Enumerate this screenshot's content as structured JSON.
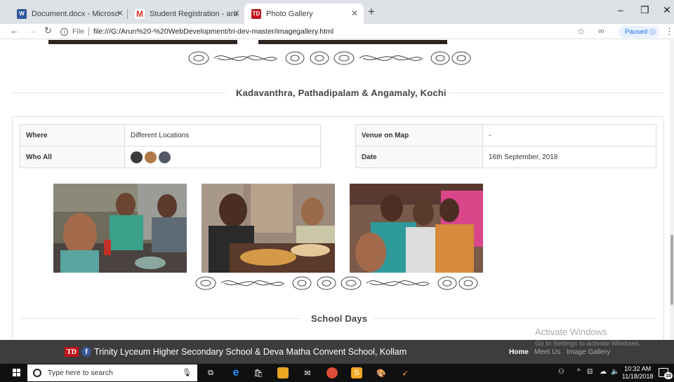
{
  "browser": {
    "tabs": [
      {
        "title": "Document.docx - Microsoft Word",
        "favicon": "word-icon",
        "active": false
      },
      {
        "title": "Student Registration - arunparel",
        "favicon": "gmail-icon",
        "active": false
      },
      {
        "title": "Photo Gallery",
        "favicon": "td-icon",
        "active": true
      }
    ],
    "new_tab_icon": "plus-icon",
    "window_controls": {
      "minimize": "–",
      "restore": "❐",
      "close": "✕"
    },
    "url_scheme_label": "File",
    "url": "file:///G:/Arun%20-%20WebDevelopment/tri-dev-master/imagegallery.html",
    "profile_status": "Paused"
  },
  "page": {
    "section1": {
      "heading": "Kadavanthra, Pathadipalam & Angamaly, Kochi",
      "details_left": [
        {
          "label": "Where",
          "value": "Different Locations"
        },
        {
          "label": "Who All",
          "value": ""
        }
      ],
      "details_right": [
        {
          "label": "Venue on Map",
          "value": "-"
        },
        {
          "label": "Date",
          "value": "16th September, 2018"
        }
      ],
      "avatar_colors": [
        "#3a3a3a",
        "#b07a4a",
        "#555b66"
      ]
    },
    "section2": {
      "heading": "School Days"
    }
  },
  "footer": {
    "title": "Trinity Lyceum Higher Secondary School & Deva Matha Convent School, Kollam",
    "logo_text": "TD",
    "social_icon": "facebook-icon",
    "nav": [
      "Home",
      "Meet Us",
      "Image Gallery"
    ]
  },
  "watermark": {
    "line1": "Activate Windows",
    "line2": "Go to Settings to activate Windows."
  },
  "taskbar": {
    "search_placeholder": "Type here to search",
    "time": "10:32 AM",
    "date": "11/18/2018",
    "notification_count": "10"
  },
  "colors": {
    "footer_bg": "#3d3d3d",
    "td_red": "#c0141b",
    "chrome_blue": "#1a73e8"
  }
}
